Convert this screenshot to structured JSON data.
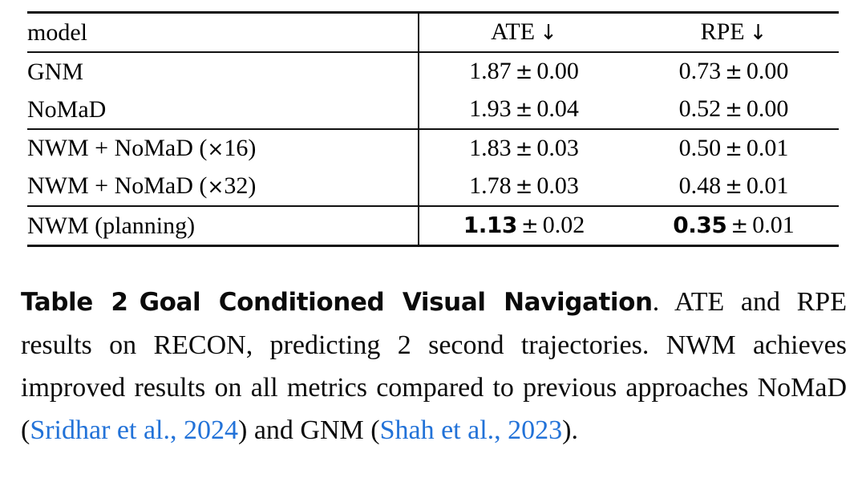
{
  "table": {
    "columns": [
      {
        "key": "model",
        "label": "model",
        "align": "left"
      },
      {
        "key": "ate",
        "label": "ATE",
        "arrow": "↓",
        "align": "center"
      },
      {
        "key": "rpe",
        "label": "RPE",
        "arrow": "↓",
        "align": "center"
      }
    ],
    "groups": [
      {
        "rows": [
          {
            "model": "GNM",
            "ate_value": "1.87",
            "ate_pm": "±",
            "ate_err": "0.00",
            "ate_bold": false,
            "rpe_value": "0.73",
            "rpe_pm": "±",
            "rpe_err": "0.00",
            "rpe_bold": false
          },
          {
            "model": "NoMaD",
            "ate_value": "1.93",
            "ate_pm": "±",
            "ate_err": "0.04",
            "ate_bold": false,
            "rpe_value": "0.52",
            "rpe_pm": "±",
            "rpe_err": "0.00",
            "rpe_bold": false
          }
        ]
      },
      {
        "rows": [
          {
            "model": "NWM + NoMaD (×16)",
            "ate_value": "1.83",
            "ate_pm": "±",
            "ate_err": "0.03",
            "ate_bold": false,
            "rpe_value": "0.50",
            "rpe_pm": "±",
            "rpe_err": "0.01",
            "rpe_bold": false
          },
          {
            "model": "NWM + NoMaD (×32)",
            "ate_value": "1.78",
            "ate_pm": "±",
            "ate_err": "0.03",
            "ate_bold": false,
            "rpe_value": "0.48",
            "rpe_pm": "±",
            "rpe_err": "0.01",
            "rpe_bold": false
          }
        ]
      },
      {
        "rows": [
          {
            "model": "NWM (planning)",
            "ate_value": "1.13",
            "ate_pm": "±",
            "ate_err": "0.02",
            "ate_bold": true,
            "rpe_value": "0.35",
            "rpe_pm": "±",
            "rpe_err": "0.01",
            "rpe_bold": true
          }
        ]
      }
    ]
  },
  "caption": {
    "label": "Table 2",
    "title": "Goal Conditioned Visual Navigation",
    "body_segments": [
      {
        "text": ". ATE and RPE results on RECON, predicting 2 second trajectories. NWM achieves improved results on all metrics compared to previous approaches NoMaD (",
        "cite": false
      },
      {
        "text": "Sridhar et al., 2024",
        "cite": true
      },
      {
        "text": ") and GNM (",
        "cite": false
      },
      {
        "text": "Shah et al., 2023",
        "cite": true
      },
      {
        "text": ").",
        "cite": false
      }
    ]
  },
  "colors": {
    "text": "#0b0b0b",
    "rule": "#111111",
    "citation_link": "#2272d8",
    "background": "#ffffff"
  }
}
